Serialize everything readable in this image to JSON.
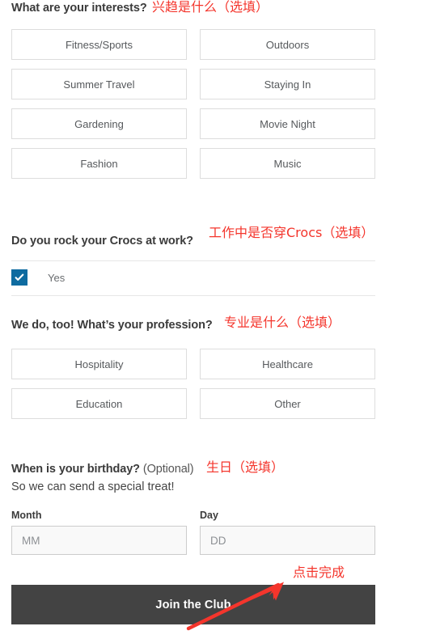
{
  "form": {
    "interests": {
      "heading": "What are your interests?",
      "options": [
        "Fitness/Sports",
        "Outdoors",
        "Summer Travel",
        "Staying In",
        "Gardening",
        "Movie Night",
        "Fashion",
        "Music"
      ]
    },
    "crocs_at_work": {
      "heading": "Do you rock your Crocs at work?",
      "checkbox_label": "Yes",
      "checkbox_checked": true,
      "checkbox_color": "#0e6ba0"
    },
    "profession": {
      "heading": "We do, too! What’s your profession?",
      "options": [
        "Hospitality",
        "Healthcare",
        "Education",
        "Other"
      ]
    },
    "birthday": {
      "heading": "When is your birthday?",
      "optional_note": " (Optional)",
      "subtext": "So we can send a special treat!",
      "month_label": "Month",
      "month_value": "",
      "month_placeholder": "MM",
      "day_label": "Day",
      "day_value": "",
      "day_placeholder": "DD"
    },
    "submit_label": "Join the Club"
  },
  "annotations": {
    "color": "#f4352c",
    "interests": "兴趋是什么（选填）",
    "crocs": "工作中是否穿Crocs（选填）",
    "profession": "专业是什么（选填）",
    "birthday": "生日（选填）",
    "submit": "点击完成"
  }
}
